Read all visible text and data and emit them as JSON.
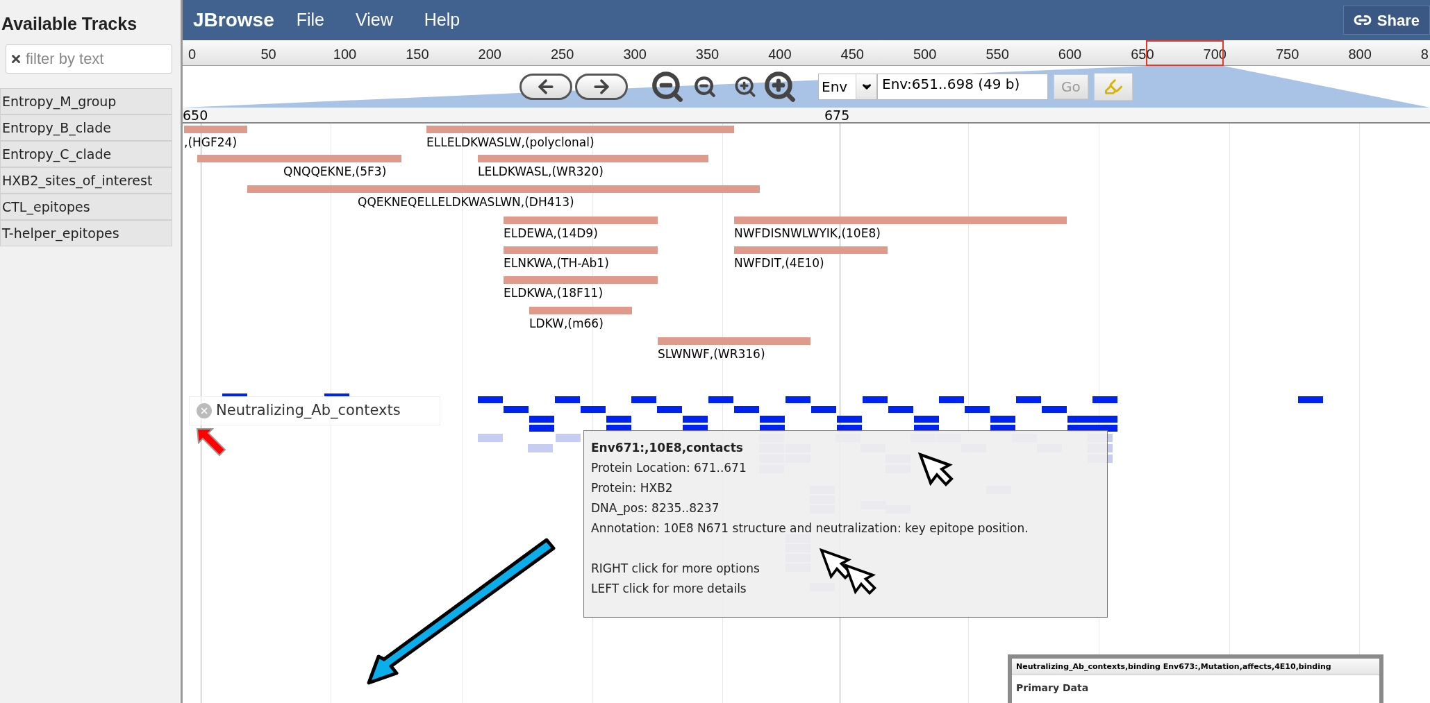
{
  "sidebar": {
    "title": "Available Tracks",
    "filter": {
      "placeholder": "filter by text"
    },
    "tracks": [
      {
        "label": "Entropy_M_group"
      },
      {
        "label": "Entropy_B_clade"
      },
      {
        "label": "Entropy_C_clade"
      },
      {
        "label": "HXB2_sites_of_interest"
      },
      {
        "label": "CTL_epitopes"
      },
      {
        "label": "T-helper_epitopes"
      }
    ]
  },
  "menu_bar": {
    "logo": "JBrowse",
    "menus": [
      "File",
      "View",
      "Help"
    ],
    "share": "Share"
  },
  "ruler": {
    "ticks": [
      "0",
      "50",
      "100",
      "150",
      "200",
      "250",
      "300",
      "350",
      "400",
      "450",
      "500",
      "550",
      "600",
      "650",
      "700",
      "750",
      "800",
      "8"
    ]
  },
  "navigation": {
    "sequence": "Env",
    "location": "Env:651..698 (49 b)",
    "go": {
      "label": "Go",
      "disabled": true
    }
  },
  "scale_labels": [
    "650",
    "675"
  ],
  "features": [
    {
      "label": ",(HGF24)"
    },
    {
      "label": "ELLELDKWASLW,(polyclonal)"
    },
    {
      "label": "QNQQEKNE,(5F3)"
    },
    {
      "label": "LELDKWASL,(WR320)"
    },
    {
      "label": "QQEKNEQELLELDKWASLWN,(DH413)"
    },
    {
      "label": "ELDEWA,(14D9)"
    },
    {
      "label": "NWFDISNWLWYIK,(10E8)"
    },
    {
      "label": "ELNKWA,(TH-Ab1)"
    },
    {
      "label": "NWFDIT,(4E10)"
    },
    {
      "label": "ELDKWA,(18F11)"
    },
    {
      "label": "LDKW,(m66)"
    },
    {
      "label": "SLWNWF,(WR316)"
    }
  ],
  "context_track": {
    "label": "Neutralizing_Ab_contexts"
  },
  "tooltip": {
    "title": "Env671:,10E8,contacts",
    "lines": [
      "Protein Location: 671..671",
      "Protein: HXB2",
      "DNA_pos: 8235..8237",
      "Annotation: 10E8 N671 structure and neutralization: key epitope position."
    ],
    "hints": [
      "RIGHT click for more options",
      "LEFT click for more details"
    ]
  },
  "detail_panel": {
    "title": "Neutralizing_Ab_contexts,binding Env673:,Mutation,affects,4E10,binding",
    "section": "Primary Data"
  }
}
